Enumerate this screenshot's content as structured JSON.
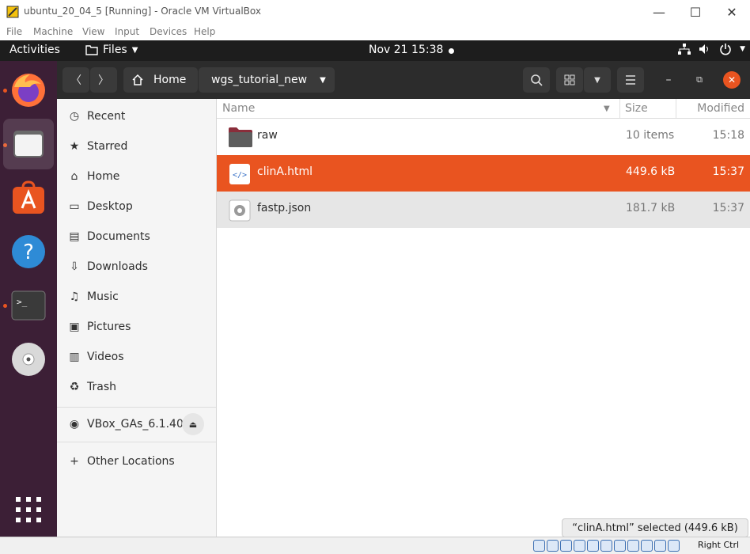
{
  "window": {
    "title": "ubuntu_20_04_5 [Running] - Oracle VM VirtualBox"
  },
  "vbox_menu": [
    "File",
    "Machine",
    "View",
    "Input",
    "Devices",
    "Help"
  ],
  "topbar": {
    "activities": "Activities",
    "app_menu": "Files",
    "clock": "Nov 21  15:38"
  },
  "breadcrumb": {
    "home": "Home",
    "current": "wgs_tutorial_new"
  },
  "sidebar": {
    "places": [
      {
        "label": "Recent",
        "icon": "clock-icon"
      },
      {
        "label": "Starred",
        "icon": "star-icon"
      },
      {
        "label": "Home",
        "icon": "home-icon"
      },
      {
        "label": "Desktop",
        "icon": "desktop-icon"
      },
      {
        "label": "Documents",
        "icon": "document-icon"
      },
      {
        "label": "Downloads",
        "icon": "download-icon"
      },
      {
        "label": "Music",
        "icon": "music-icon"
      },
      {
        "label": "Pictures",
        "icon": "picture-icon"
      },
      {
        "label": "Videos",
        "icon": "video-icon"
      },
      {
        "label": "Trash",
        "icon": "trash-icon"
      }
    ],
    "device": "VBox_GAs_6.1.40",
    "other": "Other Locations"
  },
  "columns": {
    "name": "Name",
    "size": "Size",
    "modified": "Modified"
  },
  "files": [
    {
      "name": "raw",
      "size": "10 items",
      "modified": "15:18",
      "icon": "folder-icon"
    },
    {
      "name": "clinA.html",
      "size": "449.6 kB",
      "modified": "15:37",
      "icon": "html-file-icon"
    },
    {
      "name": "fastp.json",
      "size": "181.7 kB",
      "modified": "15:37",
      "icon": "json-file-icon"
    }
  ],
  "status_text": "“clinA.html” selected  (449.6 kB)",
  "vbox_status": {
    "host_key": "Right Ctrl"
  },
  "colors": {
    "accent": "#e95420",
    "headerbar": "#2c2c2c",
    "dock": "#3c1f36"
  }
}
